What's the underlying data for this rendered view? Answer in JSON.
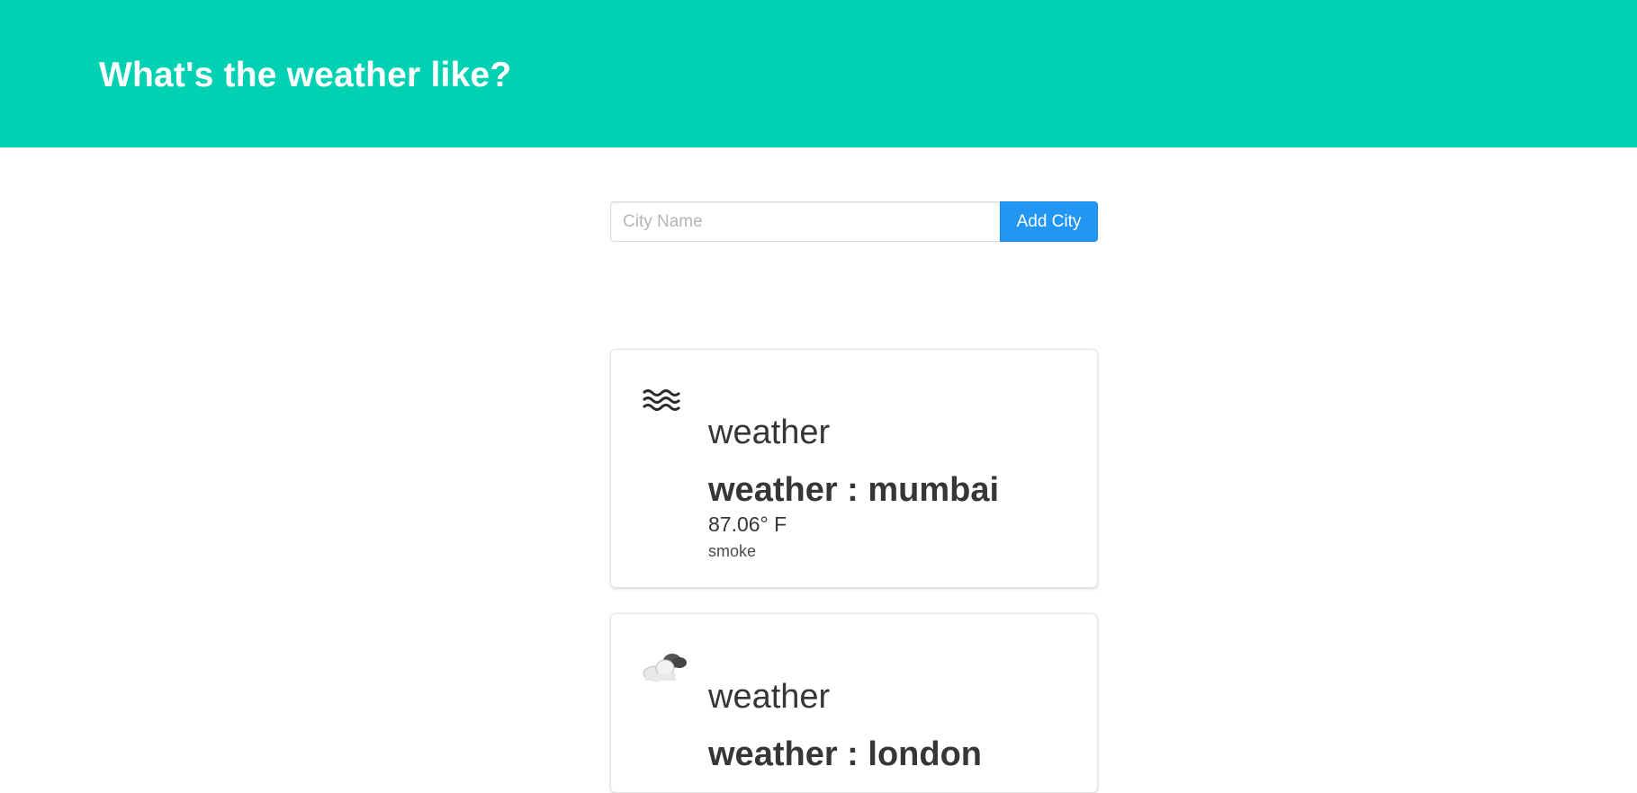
{
  "hero": {
    "title": "What's the weather like?"
  },
  "search": {
    "placeholder": "City Name",
    "value": "",
    "button_label": "Add City"
  },
  "cards": [
    {
      "icon": "fog-icon",
      "heading": "weather",
      "city_line": "weather : mumbai",
      "temperature": "87.06° F",
      "description": "smoke"
    },
    {
      "icon": "cloudy-night-icon",
      "heading": "weather",
      "city_line": "weather : london"
    }
  ],
  "colors": {
    "hero_background": "#00d1b2",
    "button_background": "#2196f3",
    "text": "#363636"
  }
}
